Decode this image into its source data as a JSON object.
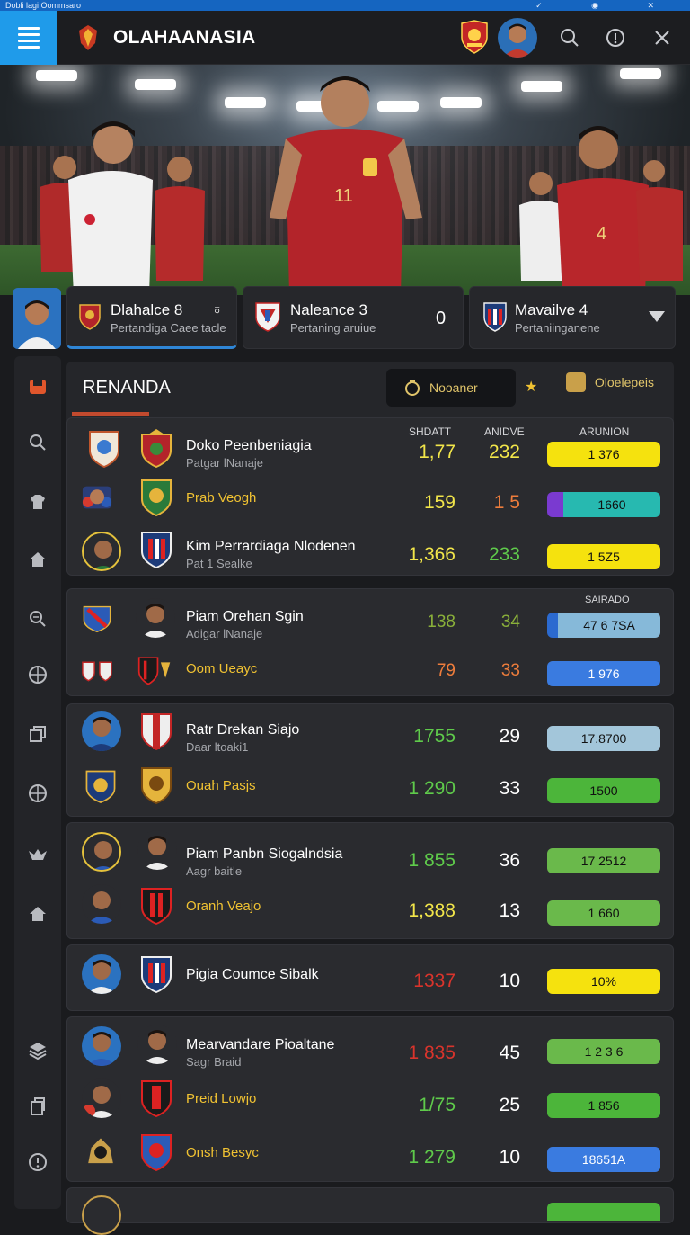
{
  "status_bar": {
    "title": "Dobli lagi Oommsaro"
  },
  "header": {
    "brand": "OLAHAANASIA"
  },
  "matches": [
    {
      "title": "Dlahalce 8",
      "subtitle": "Pertandiga Caee tacle",
      "value": ""
    },
    {
      "title": "Naleance 3",
      "subtitle": "Pertaning aruiue",
      "value": "0"
    },
    {
      "title": "Mavailve 4",
      "subtitle": "Pertaniinganene",
      "value": ""
    }
  ],
  "panel": {
    "title": "RENANDA",
    "tab_active": "Nooaner",
    "tab_other": "Oloelepeis",
    "col_a": "SHDATT",
    "col_b": "ANIDVE",
    "col_c": "ARUNION",
    "col_c2": "SAIRADO"
  },
  "rows": [
    {
      "name": "Doko Peenbeniagia",
      "sub": "Patgar lNanaje",
      "v1": "1,77",
      "v2": "232",
      "bar": "1 376",
      "bar_pct": 100,
      "v1_color": "#f2e64a",
      "v2_color": "#f2e64a",
      "bar_color": "#f5e20e"
    },
    {
      "name": "Prab Veogh",
      "sub": "",
      "v1": "159",
      "v2": "1 5",
      "bar": "1660",
      "bar_pct": 100,
      "v1_color": "#f2e64a",
      "v2_color": "#ee7d3c",
      "bar_color": "#27b9b0"
    },
    {
      "name": "Kim Perrardiaga Nlodenen",
      "sub": "Pat 1 Sealke",
      "v1": "1,366",
      "v2": "233",
      "bar": "1 5Z5",
      "bar_pct": 100,
      "v1_color": "#f2e64a",
      "v2_color": "#5fcb4b",
      "bar_color": "#f5e20e"
    },
    {
      "name": "Piam Orehan Sgin",
      "sub": "Adigar lNanaje",
      "v1": "138",
      "v2": "34",
      "bar": "47 6 7SA",
      "bar_pct": 100,
      "v1_color": "#8ab03a",
      "v2_color": "#8ab03a",
      "bar_color": "#86b9d9"
    },
    {
      "name": "Oom Ueayc",
      "sub": "",
      "v1": "79",
      "v2": "33",
      "bar": "1 976",
      "bar_pct": 100,
      "v1_color": "#ee7d3c",
      "v2_color": "#ee7d3c",
      "bar_color": "#3a7be0"
    },
    {
      "name": "Ratr Drekan Siajo",
      "sub": "Daar ltoaki1",
      "v1": "1755",
      "v2": "29",
      "bar": "17.8700",
      "bar_pct": 100,
      "v1_color": "#5fcb4b",
      "v2_color": "#ffffff",
      "bar_color": "#a3c6da"
    },
    {
      "name": "Ouah Pasjs",
      "sub": "",
      "v1": "1 290",
      "v2": "33",
      "bar": "1500",
      "bar_pct": 100,
      "v1_color": "#5fcb4b",
      "v2_color": "#ffffff",
      "bar_color": "#4cb53a"
    },
    {
      "name": "Piam Panbn Siogalndsia",
      "sub": "Aagr baitle",
      "v1": "1 855",
      "v2": "36",
      "bar": "17 2512",
      "bar_pct": 100,
      "v1_color": "#5fcb4b",
      "v2_color": "#ffffff",
      "bar_color": "#6ab94b"
    },
    {
      "name": "Oranh Veajo",
      "sub": "",
      "v1": "1,388",
      "v2": "13",
      "bar": "1 660",
      "bar_pct": 100,
      "v1_color": "#f2e64a",
      "v2_color": "#ffffff",
      "bar_color": "#6ab94b"
    },
    {
      "name": "Pigia Coumce Sibalk",
      "sub": "",
      "v1": "1337",
      "v2": "10",
      "bar": "10%",
      "bar_pct": 100,
      "v1_color": "#d9342c",
      "v2_color": "#ffffff",
      "bar_color": "#f5e20e"
    },
    {
      "name": "Mearvandare Pioaltane",
      "sub": "Sagr Braid",
      "v1": "1 835",
      "v2": "45",
      "bar": "1 2 3 6",
      "bar_pct": 100,
      "v1_color": "#d9342c",
      "v2_color": "#ffffff",
      "bar_color": "#6ab94b"
    },
    {
      "name": "Preid Lowjo",
      "sub": "",
      "v1": "1/75",
      "v2": "25",
      "bar": "1 856",
      "bar_pct": 100,
      "v1_color": "#5fcb4b",
      "v2_color": "#ffffff",
      "bar_color": "#4cb53a"
    },
    {
      "name": "Onsh Besyc",
      "sub": "",
      "v1": "1 279",
      "v2": "10",
      "bar": "18651A",
      "bar_pct": 100,
      "v1_color": "#5fcb4b",
      "v2_color": "#ffffff",
      "bar_color": "#3a7be0"
    }
  ],
  "icons": [
    "menu-icon",
    "club-logo-icon",
    "search-icon",
    "info-icon",
    "close-icon",
    "chevron-down-icon",
    "trophy-icon",
    "star-icon"
  ]
}
